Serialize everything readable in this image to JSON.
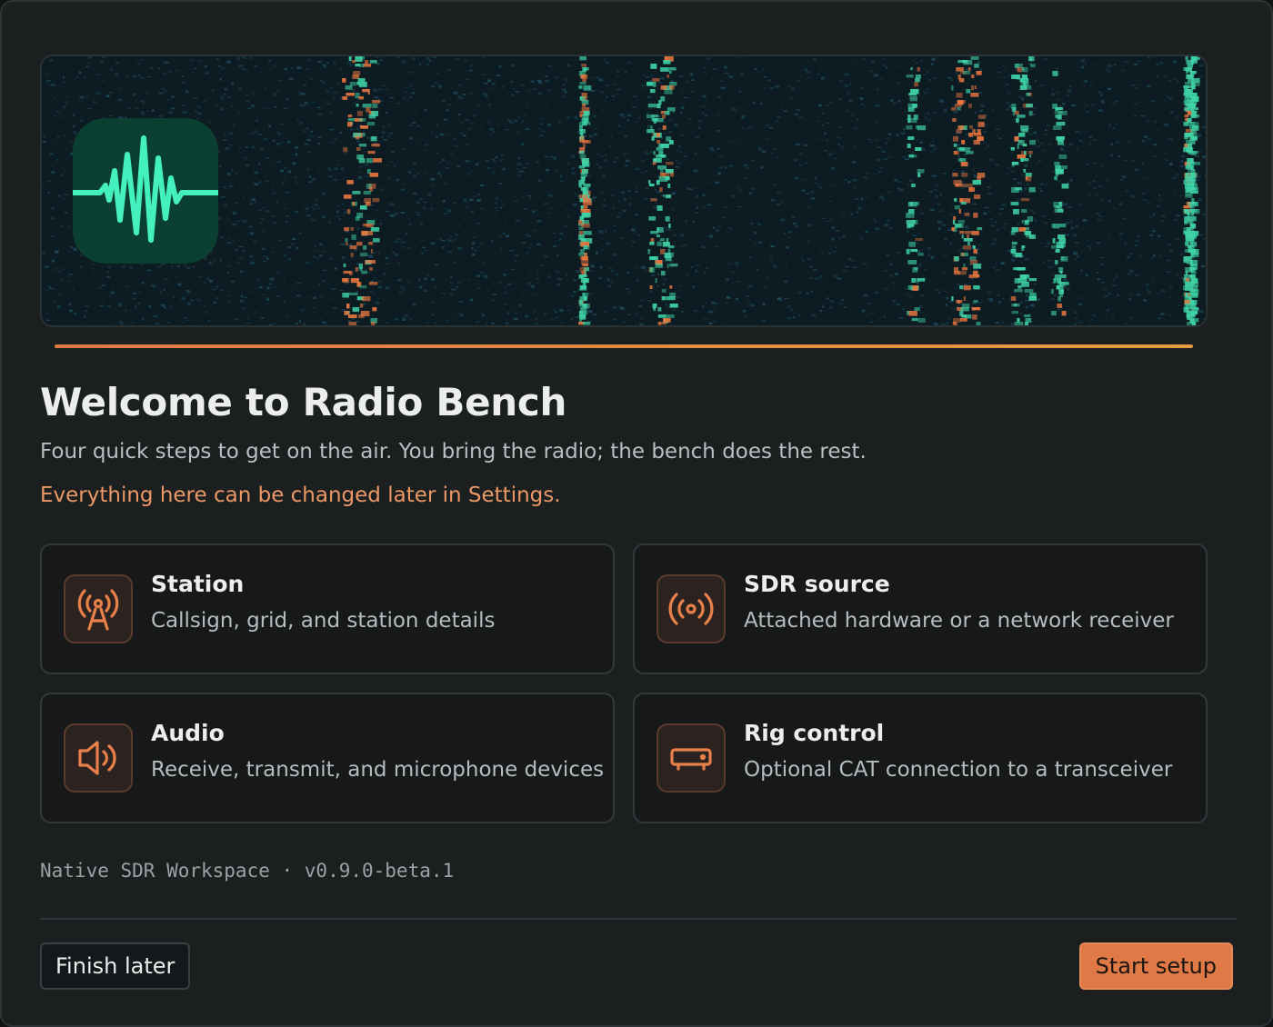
{
  "header": {
    "title": "Welcome to Radio Bench",
    "subtitle": "Four quick steps to get on the air. You bring the radio; the bench does the rest.",
    "note": "Everything here can be changed later in Settings."
  },
  "banner": {
    "icon": "waveform-icon",
    "background": "spectrogram-waterfall",
    "colors": {
      "base": "#0d1b22",
      "signal": "#3fd3a6",
      "hot": "#e8763f",
      "icon_bg": "#0b3f31",
      "icon_stroke": "#44f0be"
    }
  },
  "steps": [
    {
      "title": "Station",
      "description": "Callsign, grid, and station details",
      "icon": "antenna-tower-icon"
    },
    {
      "title": "SDR source",
      "description": "Attached hardware or a network receiver",
      "icon": "broadcast-icon"
    },
    {
      "title": "Audio",
      "description": "Receive, transmit, and microphone devices",
      "icon": "speaker-icon"
    },
    {
      "title": "Rig control",
      "description": "Optional CAT connection to a transceiver",
      "icon": "radio-rig-icon"
    }
  ],
  "footer": {
    "version": "Native SDR Workspace · v0.9.0-beta.1",
    "finish_later_label": "Finish later",
    "start_setup_label": "Start setup"
  },
  "colors": {
    "accent": "#df7a46",
    "background": "#1c1f20",
    "card": "#161819"
  }
}
